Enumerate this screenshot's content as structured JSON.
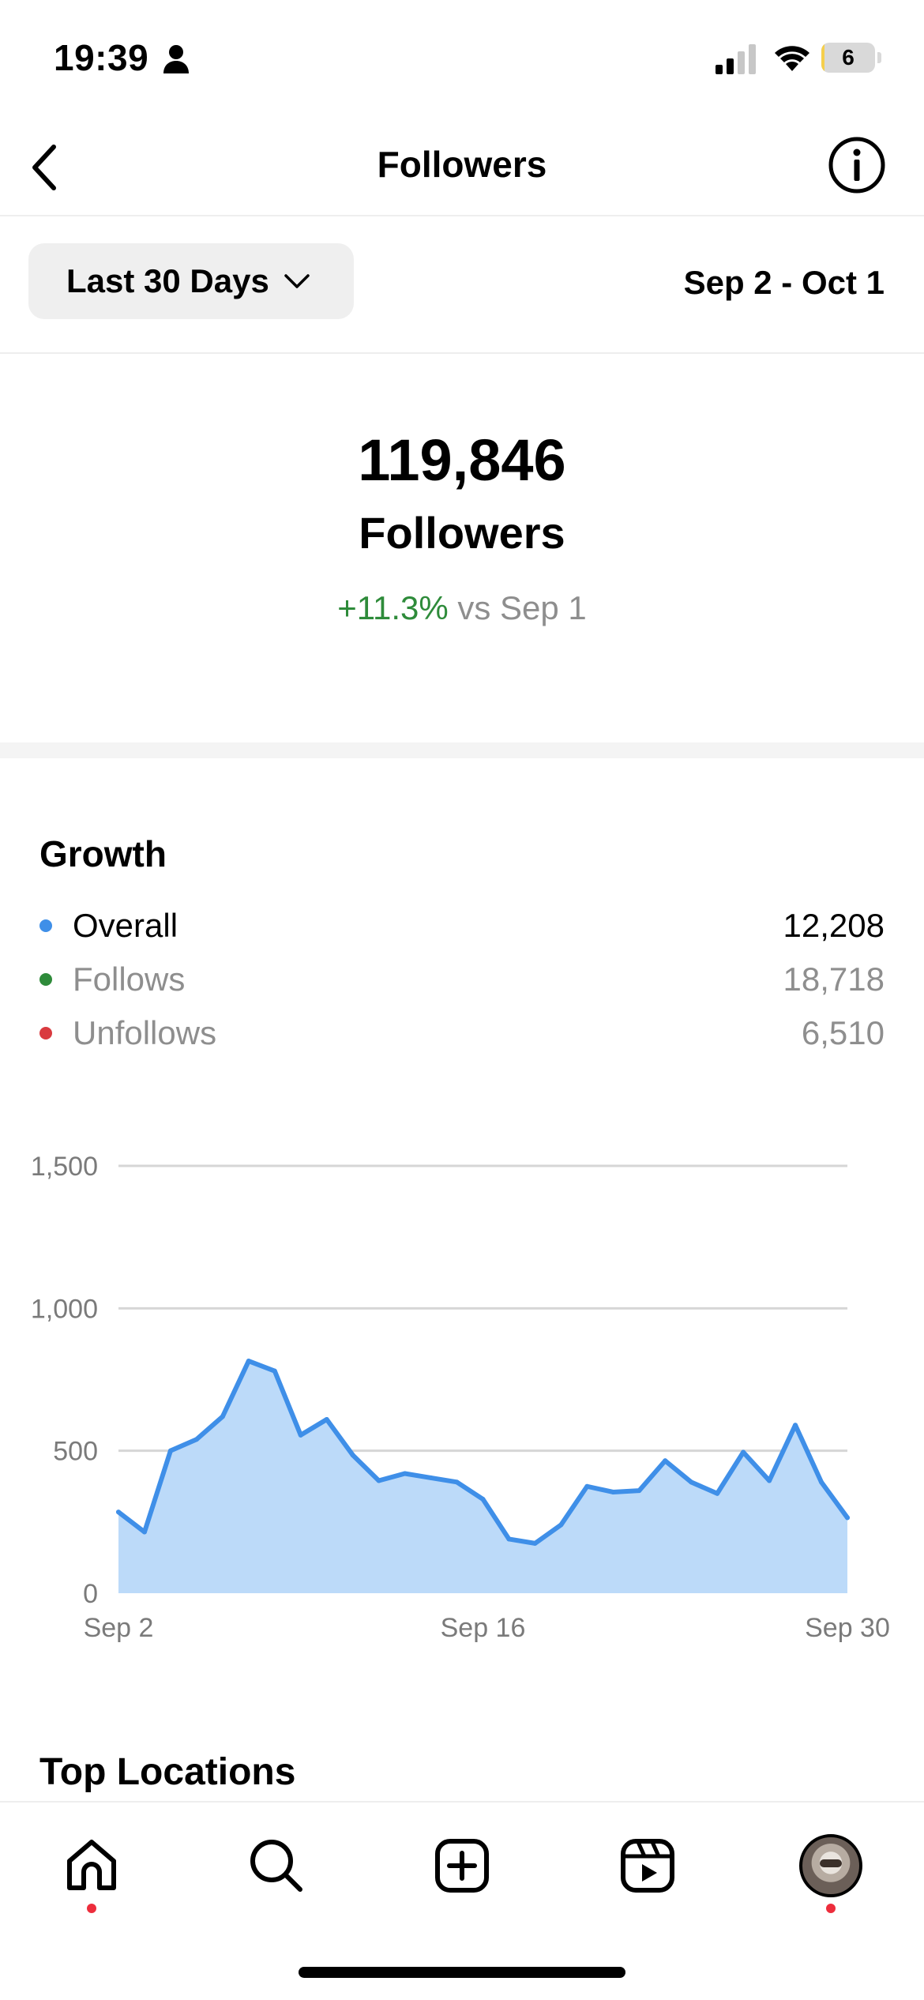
{
  "status_bar": {
    "time": "19:39",
    "battery_level": "6",
    "battery_fraction": 0.06,
    "icons": [
      "person-icon",
      "signal-icon",
      "wifi-icon",
      "battery-icon"
    ]
  },
  "header": {
    "title": "Followers",
    "back_icon": "chevron-left-icon",
    "info_icon": "info-icon"
  },
  "filter": {
    "range_label": "Last 30 Days",
    "range_icon": "chevron-down-icon",
    "date_range": "Sep 2 - Oct 1"
  },
  "summary": {
    "count": "119,846",
    "label": "Followers",
    "change_value": "+11.3%",
    "change_suffix": "vs Sep 1"
  },
  "growth": {
    "title": "Growth",
    "legend": [
      {
        "label": "Overall",
        "value": "12,208",
        "color": "#3f8fe8"
      },
      {
        "label": "Follows",
        "value": "18,718",
        "color": "#2e8b3a"
      },
      {
        "label": "Unfollows",
        "value": "6,510",
        "color": "#d93a3f"
      }
    ]
  },
  "chart_data": {
    "type": "area",
    "title": "",
    "xlabel": "",
    "ylabel": "",
    "ylim": [
      0,
      1500
    ],
    "yticks": [
      0,
      500,
      1000,
      1500
    ],
    "ytick_labels": [
      "0",
      "500",
      "1,000",
      "1,500"
    ],
    "xtick_labels": [
      "Sep 2",
      "Sep 16",
      "Sep 30"
    ],
    "xtick_days": [
      2,
      16,
      30
    ],
    "grid": true,
    "line_color": "#3f8fe8",
    "fill_color": "#bcdaf9",
    "x_days": [
      2,
      3,
      4,
      5,
      6,
      7,
      8,
      9,
      10,
      11,
      12,
      13,
      14,
      15,
      16,
      17,
      18,
      19,
      20,
      21,
      22,
      23,
      24,
      25,
      26,
      27,
      28,
      29,
      30
    ],
    "values": [
      285,
      215,
      500,
      540,
      620,
      815,
      780,
      555,
      610,
      485,
      395,
      420,
      405,
      390,
      330,
      190,
      175,
      240,
      375,
      355,
      360,
      465,
      390,
      350,
      495,
      395,
      590,
      390,
      265
    ]
  },
  "locations": {
    "title": "Top Locations"
  },
  "tab_bar": {
    "tabs": [
      {
        "name": "home",
        "icon": "home-icon",
        "has_dot": true
      },
      {
        "name": "search",
        "icon": "search-icon",
        "has_dot": false
      },
      {
        "name": "create",
        "icon": "plus-square-icon",
        "has_dot": false
      },
      {
        "name": "reels",
        "icon": "reels-icon",
        "has_dot": false
      },
      {
        "name": "profile",
        "icon": "avatar",
        "has_dot": true
      }
    ],
    "dot_color": "#ed2d3c"
  }
}
